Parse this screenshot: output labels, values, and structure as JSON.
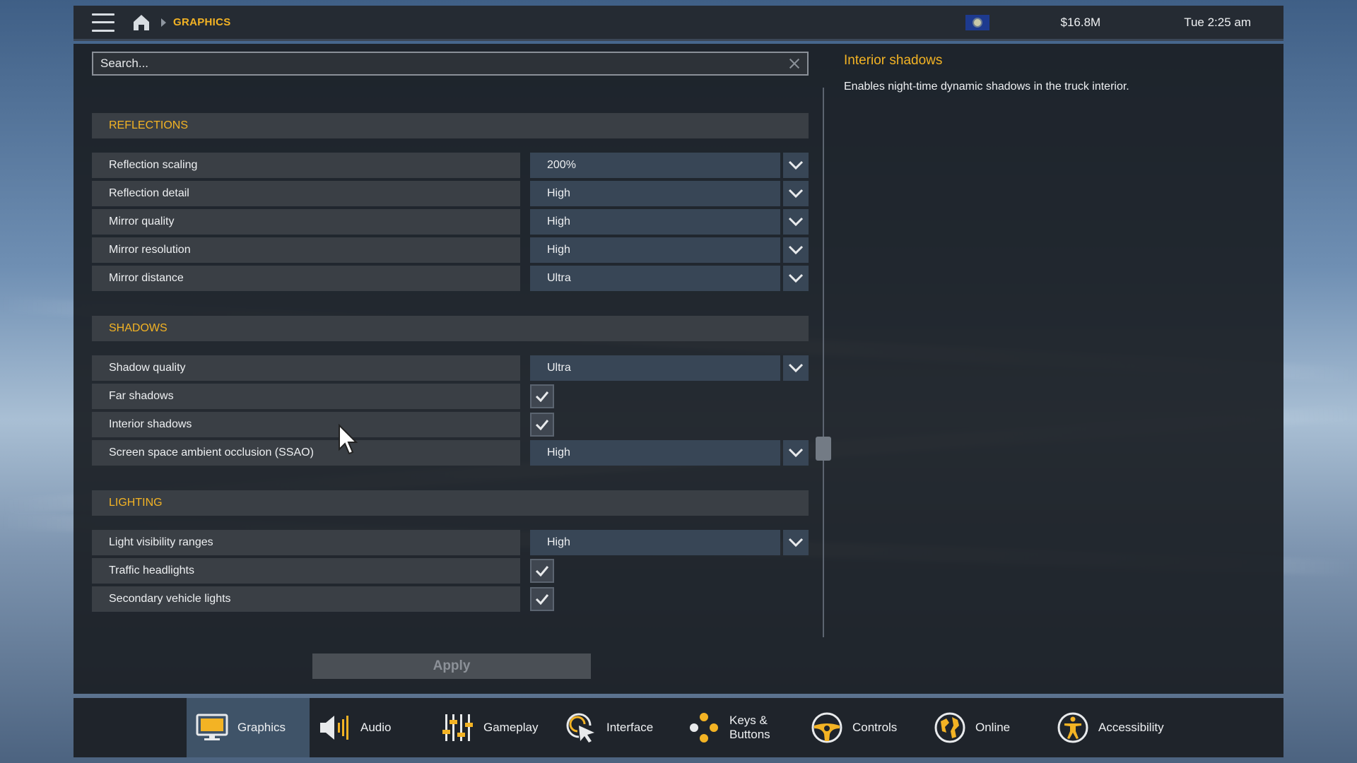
{
  "breadcrumb": {
    "current": "GRAPHICS"
  },
  "status": {
    "money": "$16.8M",
    "time": "Tue 2:25 am"
  },
  "search": {
    "placeholder": "Search..."
  },
  "sections": [
    {
      "title": "REFLECTIONS",
      "rows": [
        {
          "label": "Reflection scaling",
          "type": "dropdown",
          "value": "200%"
        },
        {
          "label": "Reflection detail",
          "type": "dropdown",
          "value": "High"
        },
        {
          "label": "Mirror quality",
          "type": "dropdown",
          "value": "High"
        },
        {
          "label": "Mirror resolution",
          "type": "dropdown",
          "value": "High"
        },
        {
          "label": "Mirror distance",
          "type": "dropdown",
          "value": "Ultra"
        }
      ]
    },
    {
      "title": "SHADOWS",
      "rows": [
        {
          "label": "Shadow quality",
          "type": "dropdown",
          "value": "Ultra"
        },
        {
          "label": "Far shadows",
          "type": "checkbox",
          "checked": true
        },
        {
          "label": "Interior shadows",
          "type": "checkbox",
          "checked": true
        },
        {
          "label": "Screen space ambient occlusion (SSAO)",
          "type": "dropdown",
          "value": "High"
        }
      ]
    },
    {
      "title": "LIGHTING",
      "rows": [
        {
          "label": "Light visibility ranges",
          "type": "dropdown",
          "value": "High"
        },
        {
          "label": "Traffic headlights",
          "type": "checkbox",
          "checked": true
        },
        {
          "label": "Secondary vehicle lights",
          "type": "checkbox",
          "checked": true
        }
      ]
    }
  ],
  "apply_label": "Apply",
  "info": {
    "title": "Interior shadows",
    "description": "Enables night-time dynamic shadows in the truck interior."
  },
  "nav": [
    {
      "label": "Graphics",
      "icon": "monitor-icon",
      "active": true
    },
    {
      "label": "Audio",
      "icon": "speaker-icon"
    },
    {
      "label": "Gameplay",
      "icon": "sliders-icon"
    },
    {
      "label": "Interface",
      "icon": "cursor-click-icon"
    },
    {
      "label": "Keys & Buttons",
      "icon": "gamepad-buttons-icon"
    },
    {
      "label": "Controls",
      "icon": "steering-wheel-icon"
    },
    {
      "label": "Online",
      "icon": "globe-icon"
    },
    {
      "label": "Accessibility",
      "icon": "accessibility-icon"
    }
  ],
  "colors": {
    "accent": "#f3b324",
    "panel": "#1b1f25",
    "row": "#3a3f45",
    "dropdown": "#384656",
    "nav_active": "#3f5368"
  }
}
